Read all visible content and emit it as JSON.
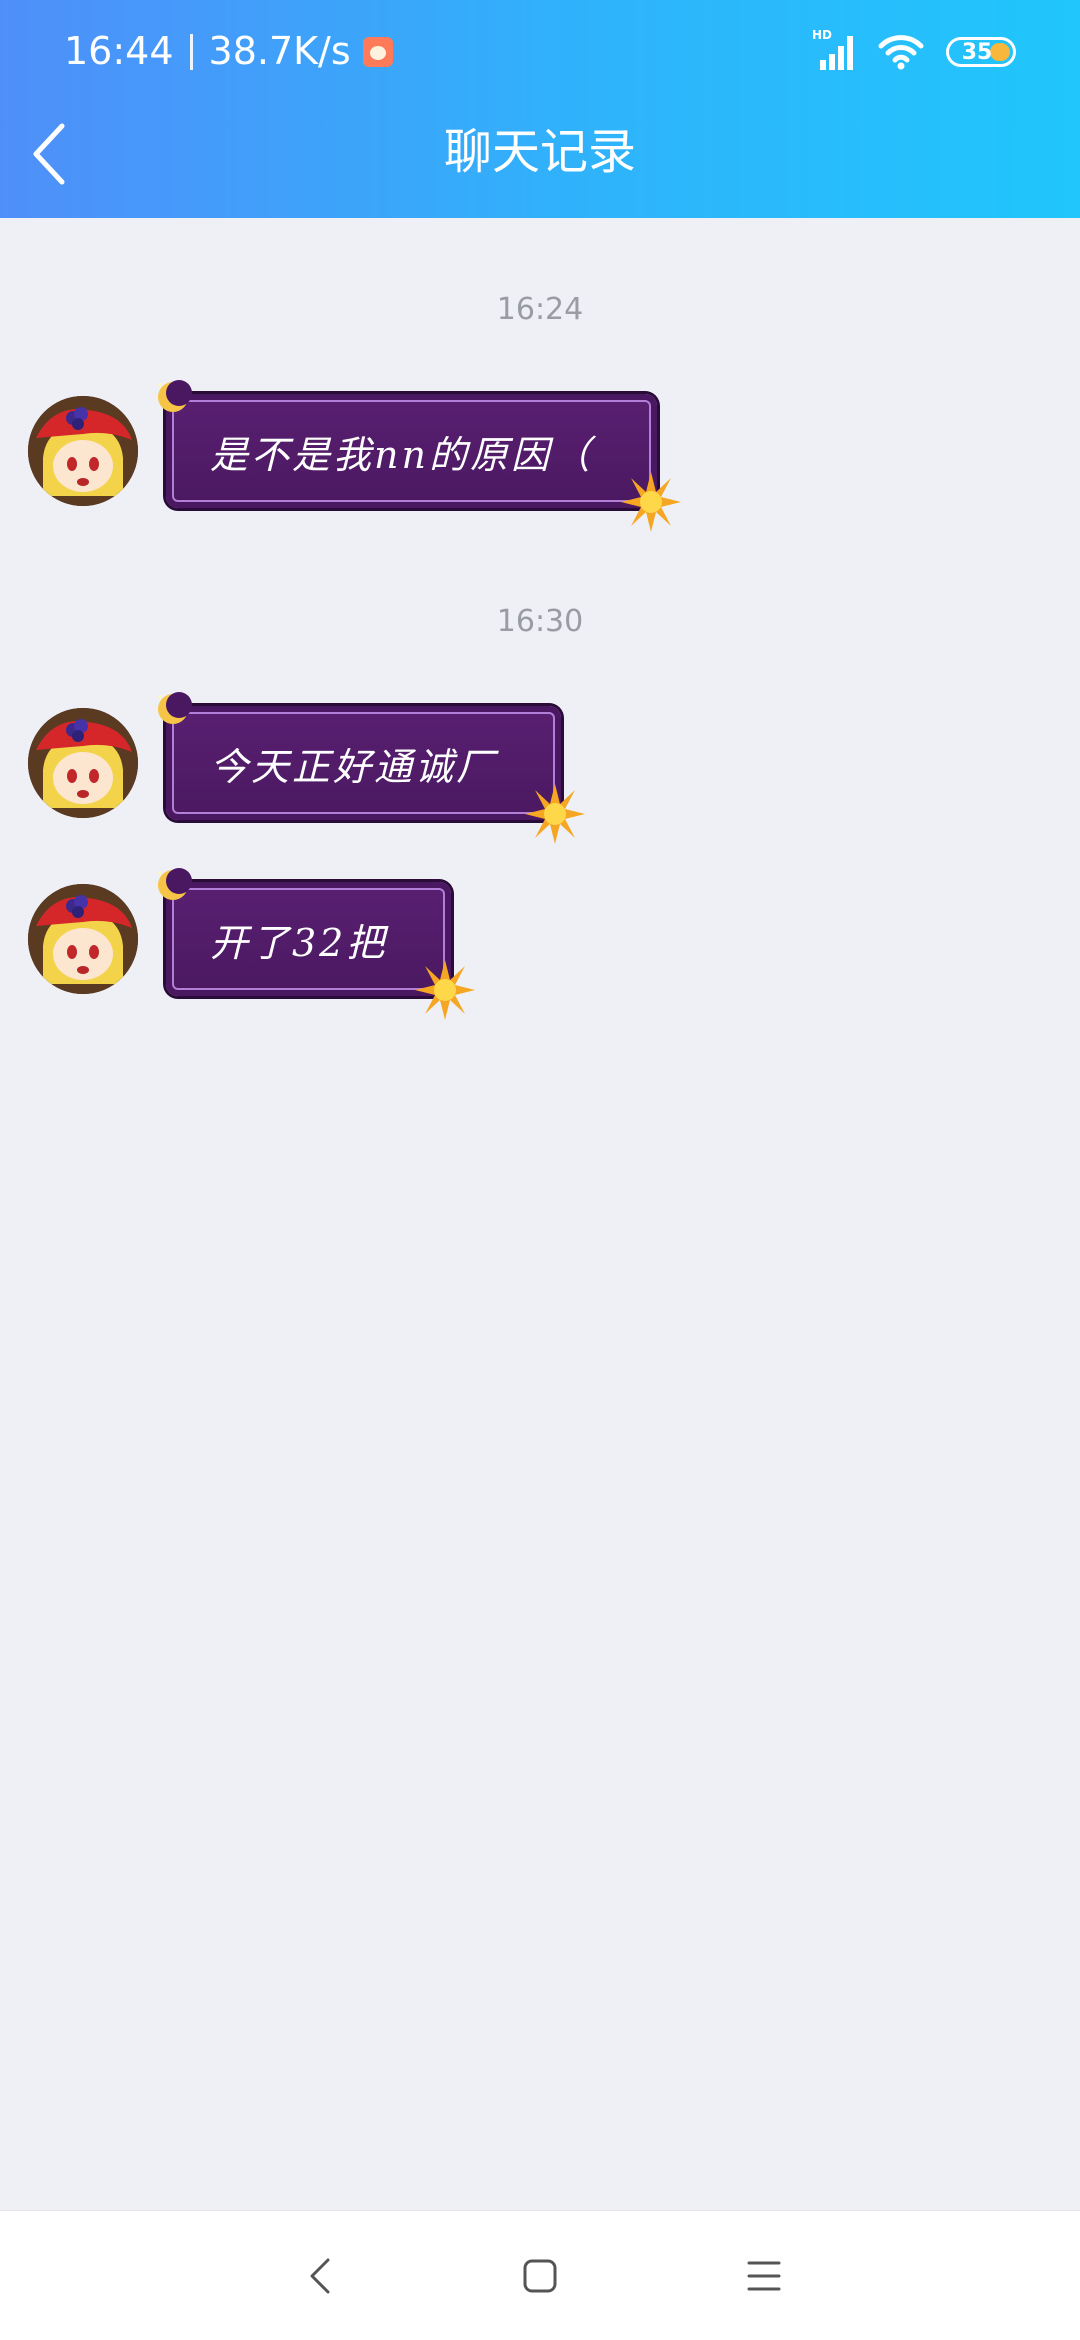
{
  "status_bar": {
    "time": "16:44",
    "network_speed": "38.7K/s",
    "signal_label": "HD",
    "battery_level": "35",
    "icons": [
      "app-notification-icon",
      "signal-icon",
      "wifi-icon",
      "battery-icon"
    ]
  },
  "header": {
    "title": "聊天记录",
    "back_icon": "chevron-left-icon",
    "gradient_start": "#4f8ff9",
    "gradient_end": "#20c6fc"
  },
  "chat": {
    "groups": [
      {
        "timestamp": "16:24",
        "messages": [
          {
            "text": "是不是我nn的原因（"
          }
        ]
      },
      {
        "timestamp": "16:30",
        "messages": [
          {
            "text": "今天正好通诚厂"
          },
          {
            "text": "开了32把"
          }
        ]
      }
    ],
    "bubble_color": "#4a1860",
    "avatar": "anime-girl-red-hat-avatar"
  },
  "system_nav": {
    "buttons": [
      "back-nav-icon",
      "home-nav-icon",
      "menu-nav-icon"
    ]
  }
}
